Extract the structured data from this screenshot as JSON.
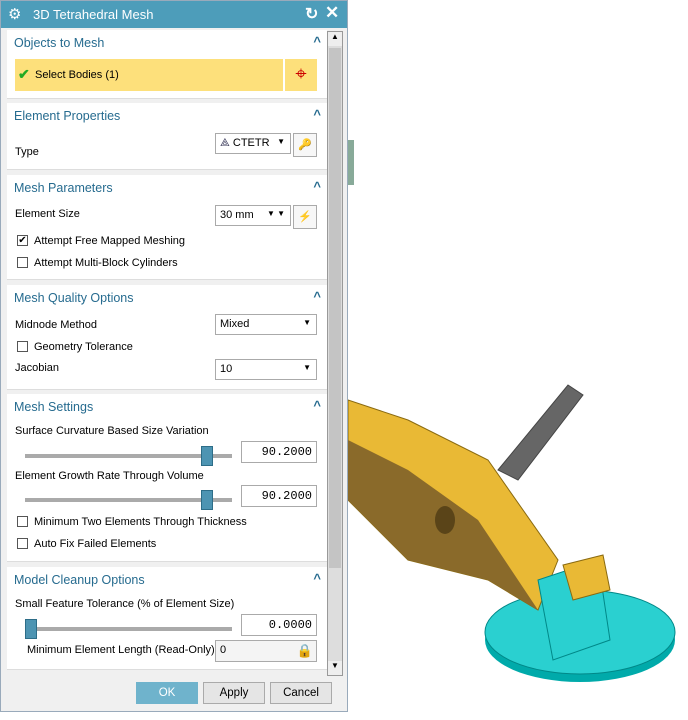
{
  "title": "3D Tetrahedral Mesh",
  "sections": {
    "objects": {
      "title": "Objects to Mesh",
      "select_label": "Select Bodies (1)"
    },
    "element": {
      "title": "Element Properties",
      "type_label": "Type",
      "type_value": "CTETR"
    },
    "mesh_params": {
      "title": "Mesh Parameters",
      "size_label": "Element Size",
      "size_value": "30 mm",
      "free_mapped": "Attempt Free Mapped Meshing",
      "free_mapped_checked": true,
      "multi_block": "Attempt Multi-Block Cylinders",
      "multi_block_checked": false
    },
    "quality": {
      "title": "Mesh Quality Options",
      "midnode_label": "Midnode Method",
      "midnode_value": "Mixed",
      "geom_tol": "Geometry Tolerance",
      "jacobian_label": "Jacobian",
      "jacobian_value": "10"
    },
    "settings": {
      "title": "Mesh Settings",
      "curv_label": "Surface Curvature Based Size Variation",
      "curv_value": "90.2000",
      "growth_label": "Element Growth Rate Through Volume",
      "growth_value": "90.2000",
      "min_two": "Minimum Two Elements Through Thickness",
      "auto_fix": "Auto Fix Failed Elements"
    },
    "cleanup": {
      "title": "Model Cleanup Options",
      "tol_label": "Small Feature Tolerance (% of Element Size)",
      "tol_value": "0.0000",
      "min_len_label": "Minimum Element Length (Read-Only)",
      "min_len_value": "0"
    }
  },
  "buttons": {
    "ok": "OK",
    "apply": "Apply",
    "cancel": "Cancel"
  },
  "colors": {
    "title_bar": "#4d9dba",
    "selection_bg": "#fde07b",
    "mesh_yellow": "#f3c33c",
    "mesh_cyan": "#2ad0d0"
  }
}
